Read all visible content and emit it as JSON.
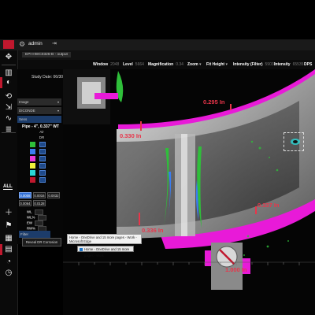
{
  "app": {
    "user": "admin",
    "tab_label": "EPI-HWC0326-B - output"
  },
  "toolbar": {
    "window_label": "Window",
    "window_value": "2048",
    "level_label": "Level",
    "level_value": "5664",
    "magnification_label": "Magnification",
    "magnification_value": "0.34",
    "zoom_label": "Zoom",
    "fit_height_label": "Fit Height",
    "intensity_filter_label": "Intensity (Filter)",
    "intensity_filter_value": "59033",
    "intensity_label": "Intensity",
    "intensity_value": "65535",
    "dps_label": "DPS"
  },
  "rail": {
    "all_label": "ALL"
  },
  "panel": {
    "study_date_label": "Study Date:",
    "study_date_value": "06/30/2022",
    "dropdowns": [
      {
        "label": "Image"
      },
      {
        "label": "DICONDE"
      },
      {
        "label": "Sens"
      }
    ],
    "pipe_title": "Pipe - 4\", 0.337\" WT",
    "air_label": "Air",
    "dr_label": "DR",
    "swatch_colors": [
      "#2fbf3a",
      "#3a7cf0",
      "#e83ad6",
      "#f2f23a",
      "#2ad6d6",
      "#c0182e"
    ],
    "values_row1": [
      "0.0008",
      "0.0016",
      "0.0032"
    ],
    "values_row2": [
      "0.0064",
      "0.0128"
    ],
    "stats": [
      "WL",
      "WL%",
      "EW",
      "RW%"
    ],
    "filter_label": "Filter",
    "reveal_button": "Reveal DR Corrosion"
  },
  "image": {
    "measurements": [
      "0.295 In",
      "0.330 In",
      "0.337 In",
      "0.336 In",
      "1.000 In"
    ],
    "tooltip": "Home - OneDrive and 15 more pages - Work - Microsoft Edge",
    "taskbar_label": "Home - OneDrive and 15 more pages - Work"
  },
  "colors": {
    "accent_red": "#c0182e",
    "measure_red": "#e8354a",
    "highlight_magenta": "#e81ad8",
    "indication_green": "#2fbf3a",
    "indication_blue": "#3a7cf0"
  }
}
